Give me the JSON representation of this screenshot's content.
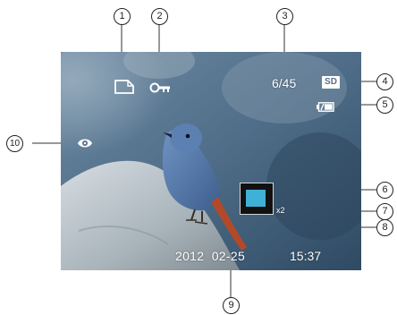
{
  "screen": {
    "photo_counter": "6/45",
    "storage_badge": "SD",
    "zoom_ratio": "x2",
    "date": "2012  02-25",
    "time": "15:37",
    "icons": {
      "protect": "protect-file-icon",
      "lock": "key-lock-icon",
      "battery": "battery-icon",
      "red_eye": "red-eye-icon",
      "zoom_frame": "zoom-position-frame-icon"
    }
  },
  "callouts": [
    "1",
    "2",
    "3",
    "4",
    "5",
    "6",
    "7",
    "8",
    "9",
    "10"
  ],
  "colors": {
    "screen_background": "#4d6b86",
    "zoom_box_fill": "#3fb0d6",
    "callout_stroke": "#222222"
  }
}
